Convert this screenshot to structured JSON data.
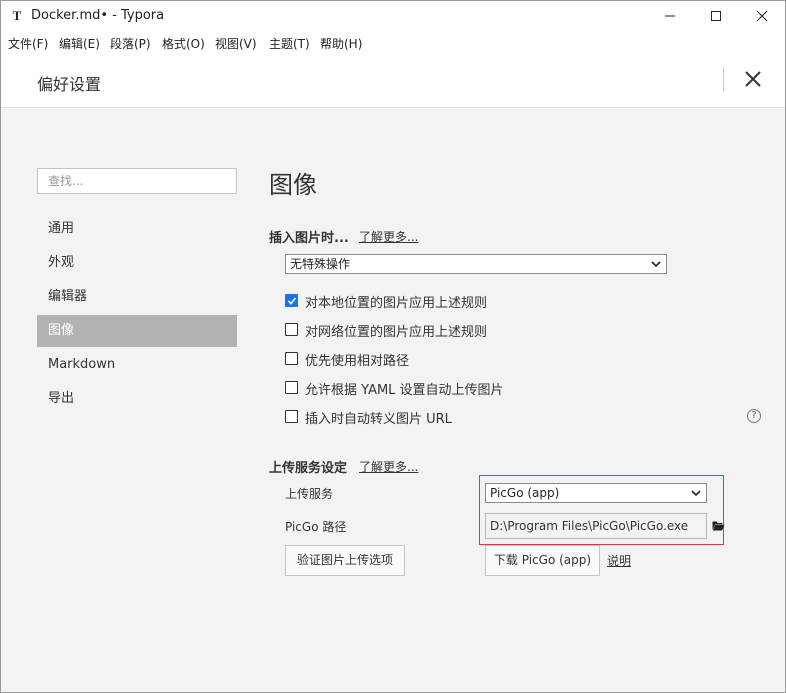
{
  "window": {
    "app_icon": "T",
    "title": "Docker.md• - Typora"
  },
  "menu": [
    {
      "label": "文件(F)"
    },
    {
      "label": "编辑(E)"
    },
    {
      "label": "段落(P)"
    },
    {
      "label": "格式(O)"
    },
    {
      "label": "视图(V)"
    },
    {
      "label": "主题(T)"
    },
    {
      "label": "帮助(H)"
    }
  ],
  "preferences": {
    "title": "偏好设置",
    "search_placeholder": "查找...",
    "nav": [
      {
        "label": "通用",
        "active": false
      },
      {
        "label": "外观",
        "active": false
      },
      {
        "label": "编辑器",
        "active": false
      },
      {
        "label": "图像",
        "active": true
      },
      {
        "label": "Markdown",
        "active": false
      },
      {
        "label": "导出",
        "active": false
      }
    ]
  },
  "image_section": {
    "title": "图像",
    "insert_group": {
      "label": "插入图片时...",
      "learn_more": "了解更多...",
      "selected_action": "无特殊操作"
    },
    "options": [
      {
        "label": "对本地位置的图片应用上述规则",
        "checked": true
      },
      {
        "label": "对网络位置的图片应用上述规则",
        "checked": false
      },
      {
        "label": "优先使用相对路径",
        "checked": false
      },
      {
        "label": "允许根据 YAML 设置自动上传图片",
        "checked": false
      },
      {
        "label": "插入时自动转义图片 URL",
        "checked": false
      }
    ],
    "help_icon": "?",
    "upload_group": {
      "label": "上传服务设定",
      "learn_more": "了解更多...",
      "service_label": "上传服务",
      "service_value": "PicGo (app)",
      "path_label": "PicGo 路径",
      "path_value": "D:\\Program Files\\PicGo\\PicGo.exe",
      "verify_button": "验证图片上传选项",
      "download_button": "下载 PicGo (app)",
      "explain_link": "说明"
    }
  },
  "colors": {
    "accent": "#1a73e8",
    "nav_active_bg": "#b2b2b2",
    "highlight_border": "#d63a3a",
    "panel_bg": "#f3f3f3"
  }
}
